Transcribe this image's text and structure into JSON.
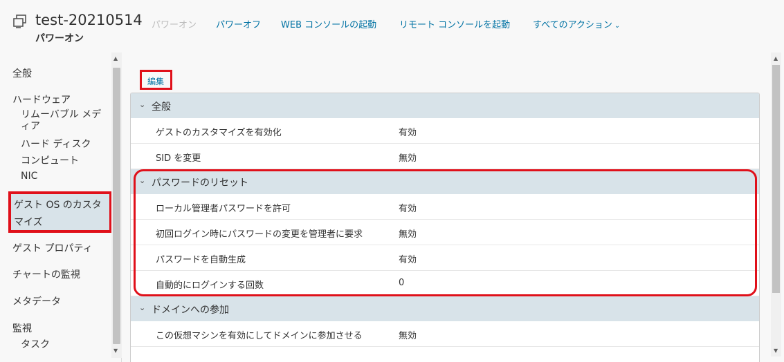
{
  "header": {
    "title": "test-20210514",
    "state": "パワーオン",
    "icon": "vm-icon",
    "actions": {
      "power_on": "パワーオン",
      "power_off": "パワーオフ",
      "web_console": "WEB コンソールの起動",
      "remote_console": "リモート コンソールを起動",
      "all_actions": "すべてのアクション"
    }
  },
  "sidebar": {
    "general": "全般",
    "hardware": "ハードウェア",
    "removable_media": "リムーバブル メディア",
    "hard_disk": "ハード ディスク",
    "computer": "コンピュート",
    "nic": "NIC",
    "guest_os_customize": "ゲスト OS のカスタマイズ",
    "guest_properties": "ゲスト プロパティ",
    "chart_monitor": "チャートの監視",
    "metadata": "メタデータ",
    "monitor": "監視",
    "tasks": "タスク"
  },
  "main": {
    "edit_label": "編集",
    "sections": {
      "general": {
        "title": "全般",
        "rows": [
          {
            "label": "ゲストのカスタマイズを有効化",
            "value": "有効"
          },
          {
            "label": "SID を変更",
            "value": "無効"
          }
        ]
      },
      "password_reset": {
        "title": "パスワードのリセット",
        "rows": [
          {
            "label": "ローカル管理者パスワードを許可",
            "value": "有効"
          },
          {
            "label": "初回ログイン時にパスワードの変更を管理者に要求",
            "value": "無効"
          },
          {
            "label": "パスワードを自動生成",
            "value": "有効"
          },
          {
            "label": "自動的にログインする回数",
            "value": "0"
          }
        ]
      },
      "domain_join": {
        "title": "ドメインへの参加",
        "rows": [
          {
            "label": "この仮想マシンを有効にしてドメインに参加させる",
            "value": "無効"
          }
        ]
      }
    }
  },
  "colors": {
    "link": "#0072a3",
    "section_bg": "#d8e3e9",
    "highlight": "#e0101a",
    "disabled": "#bcbcbc"
  }
}
